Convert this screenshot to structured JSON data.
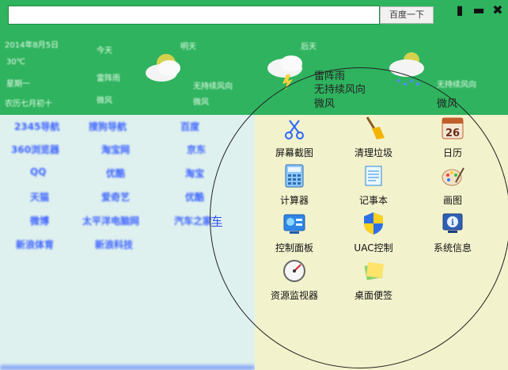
{
  "search": {
    "placeholder": "",
    "button_label": "百度一下"
  },
  "window_controls": [
    {
      "name": "restore-icon",
      "glyph": "▮"
    },
    {
      "name": "minimize-icon",
      "glyph": "▬"
    },
    {
      "name": "close-icon",
      "glyph": "✖"
    }
  ],
  "weather": {
    "visible_text": [
      {
        "id": "w1",
        "text": "雷阵雨"
      },
      {
        "id": "w2",
        "text": "无持续风向"
      },
      {
        "id": "w3",
        "text": "微风"
      },
      {
        "id": "w4",
        "text": "微风"
      }
    ],
    "blurred": [
      {
        "id": "b1",
        "text": "2014年8月5日"
      },
      {
        "id": "b2",
        "text": "今天"
      },
      {
        "id": "b3",
        "text": "明天"
      },
      {
        "id": "b4",
        "text": "后天"
      },
      {
        "id": "b5",
        "text": "30℃"
      },
      {
        "id": "b6",
        "text": "星期一"
      },
      {
        "id": "b7",
        "text": "雷阵雨"
      },
      {
        "id": "b8",
        "text": "农历七月初十"
      },
      {
        "id": "b9",
        "text": "微风"
      },
      {
        "id": "b10",
        "text": "无持续风向"
      },
      {
        "id": "b11",
        "text": "微风"
      },
      {
        "id": "b12",
        "text": "无持续风向"
      }
    ]
  },
  "links": [
    {
      "id": "l1",
      "text": "2345导航"
    },
    {
      "id": "l2",
      "text": "搜狗导航"
    },
    {
      "id": "l3",
      "text": "百度"
    },
    {
      "id": "l4",
      "text": "360浏览器"
    },
    {
      "id": "l5",
      "text": "淘宝网"
    },
    {
      "id": "l6",
      "text": "京东"
    },
    {
      "id": "l7",
      "text": "QQ"
    },
    {
      "id": "l8",
      "text": "优酷"
    },
    {
      "id": "l9",
      "text": "淘宝"
    },
    {
      "id": "l10",
      "text": "天猫"
    },
    {
      "id": "l11",
      "text": "爱奇艺"
    },
    {
      "id": "l12",
      "text": "优酷"
    },
    {
      "id": "l13",
      "text": "微博"
    },
    {
      "id": "l14",
      "text": "太平洋电脑网"
    },
    {
      "id": "l15",
      "text": "汽车之家"
    },
    {
      "id": "l16",
      "text": "新浪体育"
    },
    {
      "id": "l17",
      "text": "新浪科技"
    }
  ],
  "overflow_link": "车",
  "tools": [
    {
      "id": "t1",
      "label": "屏幕截图",
      "icon": "scissors-icon"
    },
    {
      "id": "t2",
      "label": "清理垃圾",
      "icon": "broom-icon"
    },
    {
      "id": "t3",
      "label": "日历",
      "icon": "calendar-icon",
      "day": "26"
    },
    {
      "id": "t4",
      "label": "计算器",
      "icon": "calculator-icon"
    },
    {
      "id": "t5",
      "label": "记事本",
      "icon": "notepad-icon"
    },
    {
      "id": "t6",
      "label": "画图",
      "icon": "palette-icon"
    },
    {
      "id": "t7",
      "label": "控制面板",
      "icon": "control-panel-icon"
    },
    {
      "id": "t8",
      "label": "UAC控制",
      "icon": "shield-icon"
    },
    {
      "id": "t9",
      "label": "系统信息",
      "icon": "info-icon"
    },
    {
      "id": "t10",
      "label": "资源监视器",
      "icon": "gauge-icon"
    },
    {
      "id": "t11",
      "label": "桌面便签",
      "icon": "sticky-note-icon"
    }
  ],
  "colors": {
    "header": "#2fb35f",
    "left_panel": "#dff1ee",
    "right_panel": "#f2f2cd",
    "link": "#3d63ff"
  }
}
